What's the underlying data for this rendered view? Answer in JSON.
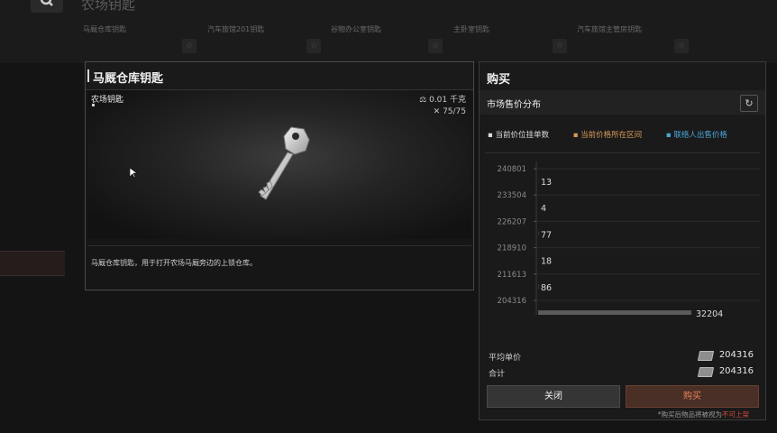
{
  "page_title": "农场钥匙",
  "tabs": [
    {
      "label": "马厩仓库钥匙"
    },
    {
      "label": "汽车旅馆201钥匙"
    },
    {
      "label": "谷物办公室钥匙"
    },
    {
      "label": "主卧室钥匙"
    },
    {
      "label": "汽车旅馆主管房钥匙"
    }
  ],
  "item": {
    "name": "马厩仓库钥匙",
    "category": "农场钥匙",
    "weight": "0.01 千克",
    "durability": "75/75",
    "description": "马厩仓库钥匙，用于打开农场马厩旁边的上锁仓库。"
  },
  "buy": {
    "title": "购买",
    "market_title": "市场售价分布",
    "legend": [
      "当前价位挂单数",
      "当前价格所在区间",
      "联络人出售价格"
    ],
    "avg_label": "平均单价",
    "avg_value": "204316",
    "total_label": "合计",
    "total_value": "204316",
    "close_label": "关闭",
    "buy_label": "购买",
    "notice_prefix": "*购买后物品将被视为",
    "notice_red": "不可上架"
  },
  "colors": {
    "accent_orange": "#d99a58",
    "accent_blue": "#4aa7d8",
    "buy_text": "#e9835b",
    "warning_red": "#d04a3a"
  },
  "chart_data": {
    "type": "bar",
    "orientation": "horizontal",
    "categories": [
      "240801",
      "233504",
      "226207",
      "218910",
      "211613",
      "204316"
    ],
    "values": [
      13,
      4,
      77,
      18,
      86,
      32204
    ],
    "series": [
      {
        "values": [
          13,
          4,
          77,
          18,
          86,
          32204
        ]
      }
    ]
  }
}
